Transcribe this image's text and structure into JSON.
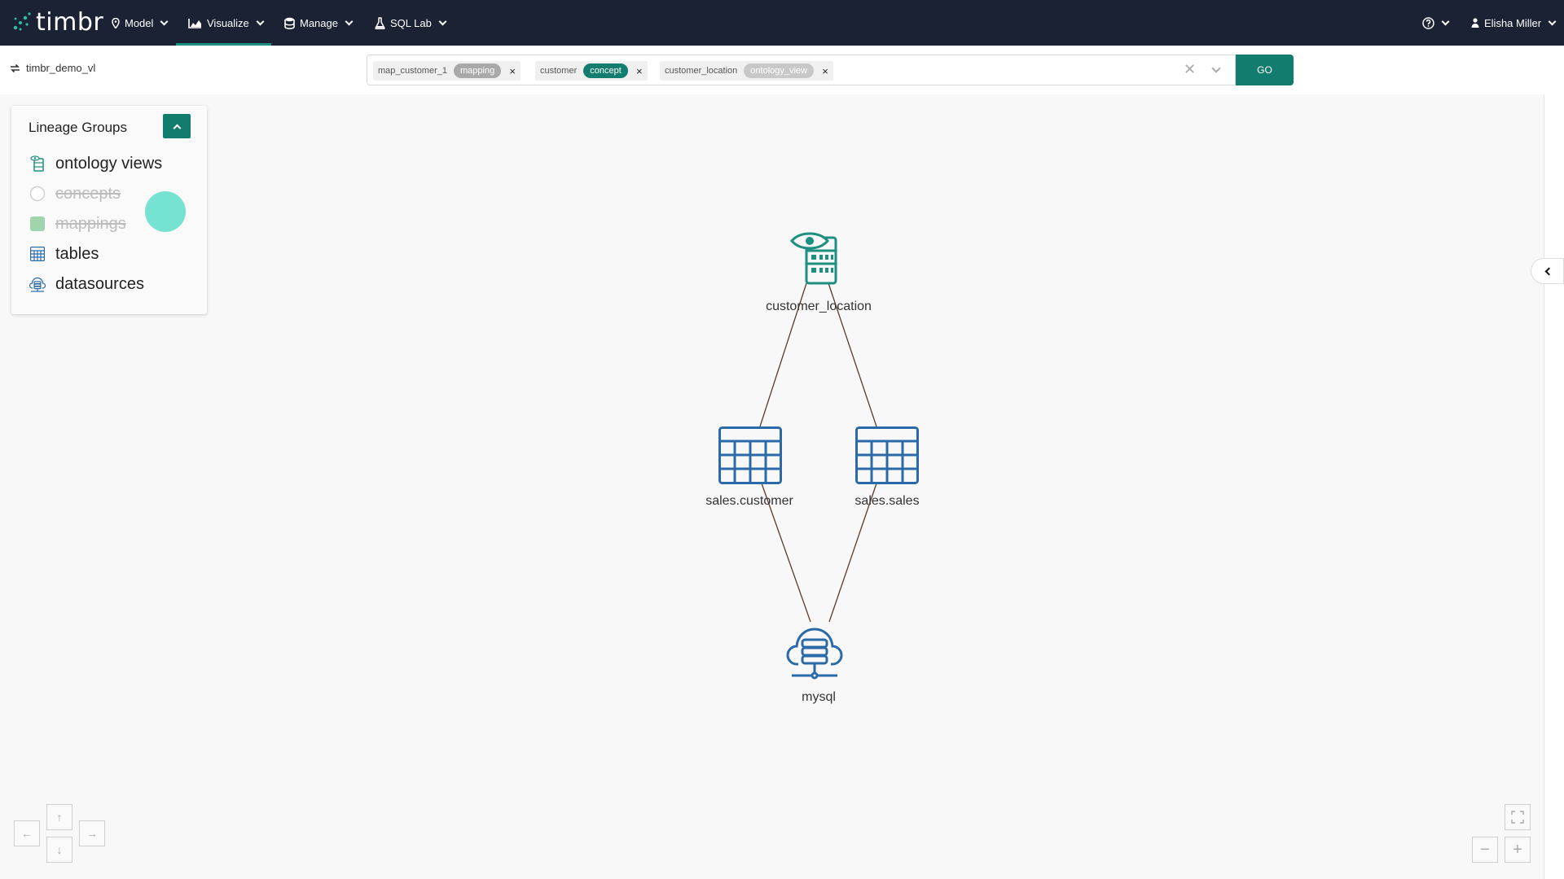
{
  "brand": {
    "name": "timbr"
  },
  "nav": {
    "items": [
      {
        "label": "Model",
        "icon": "pin-icon"
      },
      {
        "label": "Visualize",
        "icon": "chart-icon",
        "active": true
      },
      {
        "label": "Manage",
        "icon": "database-icon"
      },
      {
        "label": "SQL Lab",
        "icon": "flask-icon"
      }
    ],
    "user": {
      "name": "Elisha Miller"
    }
  },
  "toolbar": {
    "ontology_name": "timbr_demo_vl",
    "go_label": "GO",
    "chips": [
      {
        "name": "map_customer_1",
        "type": "mapping"
      },
      {
        "name": "customer",
        "type": "concept"
      },
      {
        "name": "customer_location",
        "type": "ontology_view"
      }
    ]
  },
  "lineage_groups": {
    "title": "Lineage Groups",
    "items": [
      {
        "label": "ontology views",
        "enabled": true
      },
      {
        "label": "concepts",
        "enabled": false
      },
      {
        "label": "mappings",
        "enabled": false
      },
      {
        "label": "tables",
        "enabled": true
      },
      {
        "label": "datasources",
        "enabled": true
      }
    ]
  },
  "graph": {
    "nodes": [
      {
        "id": "customer_location",
        "label": "customer_location",
        "kind": "ontology_view"
      },
      {
        "id": "sales_customer",
        "label": "sales.customer",
        "kind": "table"
      },
      {
        "id": "sales_sales",
        "label": "sales.sales",
        "kind": "table"
      },
      {
        "id": "mysql",
        "label": "mysql",
        "kind": "datasource"
      }
    ],
    "edges": [
      [
        "customer_location",
        "sales_customer"
      ],
      [
        "customer_location",
        "sales_sales"
      ],
      [
        "sales_customer",
        "mysql"
      ],
      [
        "sales_sales",
        "mysql"
      ]
    ]
  },
  "colors": {
    "nav_bg": "#1a2234",
    "accent": "#127d6f",
    "node_view": "#1d8f80",
    "node_table": "#2a6aa8",
    "edge": "#5a3a2a"
  }
}
